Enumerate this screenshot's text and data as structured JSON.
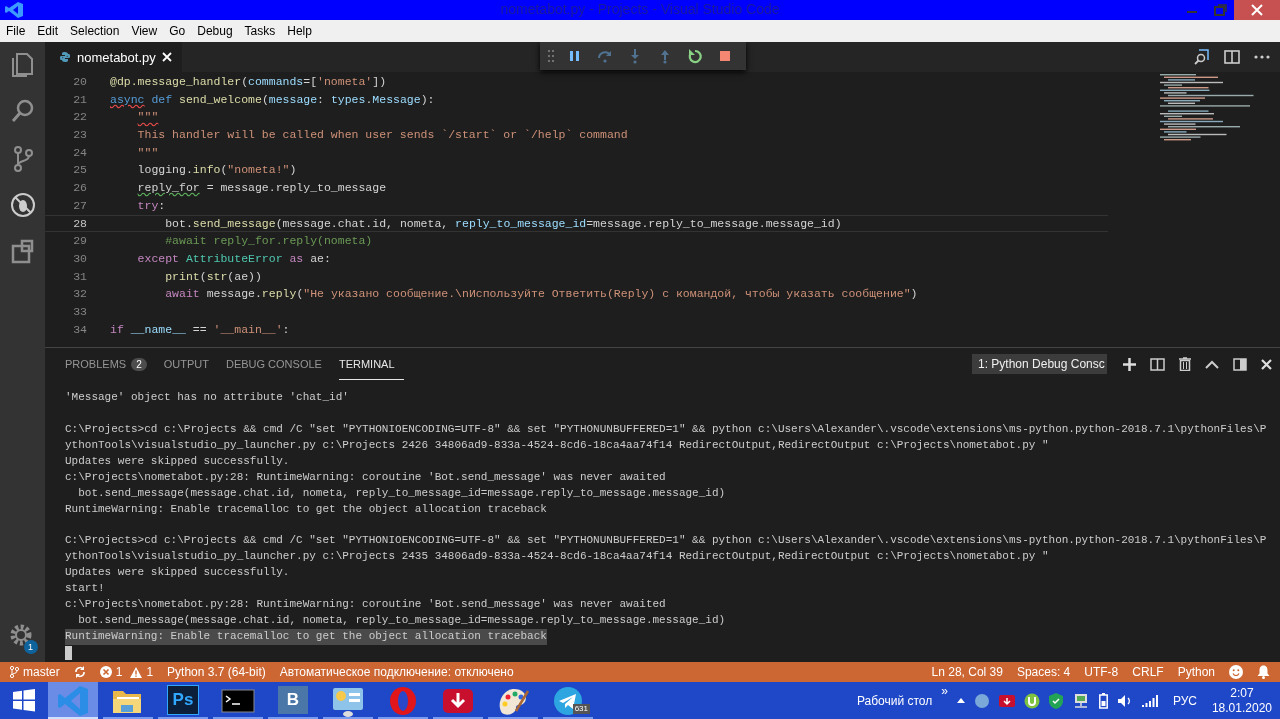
{
  "window": {
    "title": "nometabot.py - Projects - Visual Studio Code"
  },
  "menu": [
    "File",
    "Edit",
    "Selection",
    "View",
    "Go",
    "Debug",
    "Tasks",
    "Help"
  ],
  "activity_bar": {
    "items": [
      {
        "kind": "files",
        "selected": false
      },
      {
        "kind": "search",
        "selected": false
      },
      {
        "kind": "git",
        "selected": false
      },
      {
        "kind": "debug",
        "selected": true
      },
      {
        "kind": "extensions",
        "selected": false
      }
    ],
    "settings_badge": "1"
  },
  "editor": {
    "tabs": [
      {
        "label": "nometabot.py",
        "selected": true
      }
    ],
    "debug_toolbar": [
      {
        "kind": "pause",
        "disabled": false
      },
      {
        "kind": "step-over",
        "disabled": true
      },
      {
        "kind": "step-into",
        "disabled": true
      },
      {
        "kind": "step-out",
        "disabled": true
      },
      {
        "kind": "restart",
        "disabled": false
      },
      {
        "kind": "stop",
        "disabled": false
      }
    ],
    "lines": [
      {
        "number": "20",
        "current": false,
        "tokens": [
          {
            "kind": "fn",
            "text": "@dp.message_handler"
          },
          {
            "kind": "plain",
            "text": "("
          },
          {
            "kind": "var",
            "text": "commands"
          },
          {
            "kind": "plain",
            "text": "=["
          },
          {
            "kind": "str",
            "text": "'nometa'"
          },
          {
            "kind": "plain",
            "text": "])"
          }
        ]
      },
      {
        "number": "21",
        "current": false,
        "tokens": [
          {
            "kind": "kw",
            "text": "async",
            "error": true
          },
          {
            "kind": "kw",
            "text": " def"
          },
          {
            "kind": "fn",
            "text": " send_welcome"
          },
          {
            "kind": "plain",
            "text": "("
          },
          {
            "kind": "var",
            "text": "message"
          },
          {
            "kind": "plain",
            "text": ": "
          },
          {
            "kind": "var",
            "text": "types"
          },
          {
            "kind": "plain",
            "text": "."
          },
          {
            "kind": "var",
            "text": "Message"
          },
          {
            "kind": "plain",
            "text": "):"
          }
        ]
      },
      {
        "number": "22",
        "current": false,
        "tokens": [
          {
            "kind": "str",
            "text": "    \"\"\"",
            "error": true
          }
        ]
      },
      {
        "number": "23",
        "current": false,
        "tokens": [
          {
            "kind": "str",
            "text": "    This handler will be called when user sends `/start` or `/help` command"
          }
        ]
      },
      {
        "number": "24",
        "current": false,
        "tokens": [
          {
            "kind": "str",
            "text": "    \"\"\""
          }
        ]
      },
      {
        "number": "25",
        "current": false,
        "tokens": [
          {
            "kind": "plain",
            "text": "    logging."
          },
          {
            "kind": "fn",
            "text": "info"
          },
          {
            "kind": "plain",
            "text": "("
          },
          {
            "kind": "str",
            "text": "\"nometa!\""
          },
          {
            "kind": "plain",
            "text": ")"
          }
        ]
      },
      {
        "number": "26",
        "current": false,
        "tokens": [
          {
            "kind": "plain",
            "text": "    reply_for",
            "warning": true
          },
          {
            "kind": "plain",
            "text": " = message.reply_to_message"
          }
        ]
      },
      {
        "number": "27",
        "current": false,
        "tokens": [
          {
            "kind": "ctl",
            "text": "    try"
          },
          {
            "kind": "plain",
            "text": ":"
          }
        ]
      },
      {
        "number": "28",
        "current": true,
        "tokens": [
          {
            "kind": "plain",
            "text": "        bot."
          },
          {
            "kind": "fn",
            "text": "send_message"
          },
          {
            "kind": "plain",
            "text": "(message.chat.id, nometa,"
          },
          {
            "kind": "var",
            "text": " reply_to_message_id"
          },
          {
            "kind": "plain",
            "text": "=message.reply_to_message.message_id)"
          }
        ]
      },
      {
        "number": "29",
        "current": false,
        "tokens": [
          {
            "kind": "com",
            "text": "        #await reply_for.reply(nometa)"
          }
        ]
      },
      {
        "number": "30",
        "current": false,
        "tokens": [
          {
            "kind": "ctl",
            "text": "    except"
          },
          {
            "kind": "cls",
            "text": " AttributeError"
          },
          {
            "kind": "ctl",
            "text": " as"
          },
          {
            "kind": "plain",
            "text": " ae:"
          }
        ]
      },
      {
        "number": "31",
        "current": false,
        "tokens": [
          {
            "kind": "fn",
            "text": "        print"
          },
          {
            "kind": "plain",
            "text": "("
          },
          {
            "kind": "fn",
            "text": "str"
          },
          {
            "kind": "plain",
            "text": "(ae))"
          }
        ]
      },
      {
        "number": "32",
        "current": false,
        "tokens": [
          {
            "kind": "ctl",
            "text": "        await"
          },
          {
            "kind": "plain",
            "text": " message."
          },
          {
            "kind": "fn",
            "text": "reply"
          },
          {
            "kind": "plain",
            "text": "("
          },
          {
            "kind": "str",
            "text": "\"Не указано сообщение.\\nИспользуйте Ответить(Reply) с командой, чтобы указать сообщение\""
          },
          {
            "kind": "plain",
            "text": ")"
          }
        ]
      },
      {
        "number": "33",
        "current": false
      },
      {
        "number": "34",
        "current": false,
        "tokens": [
          {
            "kind": "ctl",
            "text": "if"
          },
          {
            "kind": "var",
            "text": " __name__"
          },
          {
            "kind": "plain",
            "text": " == "
          },
          {
            "kind": "str",
            "text": "'__main__'"
          },
          {
            "kind": "plain",
            "text": ":"
          }
        ]
      }
    ]
  },
  "panel": {
    "tabs": [
      {
        "label": "PROBLEMS",
        "badge": "2",
        "selected": false
      },
      {
        "label": "OUTPUT",
        "selected": false
      },
      {
        "label": "DEBUG CONSOLE",
        "selected": false
      },
      {
        "label": "TERMINAL",
        "selected": true
      }
    ],
    "terminal_select": "1: Python Debug Consc",
    "terminal": [
      {
        "kind": "text",
        "text": "'Message' object has no attribute 'chat_id'",
        "selected": false
      },
      {
        "kind": "blank",
        "selected": false
      },
      {
        "kind": "text",
        "text": "C:\\Projects>cd c:\\Projects && cmd /C \"set \"PYTHONIOENCODING=UTF-8\" && set \"PYTHONUNBUFFERED=1\" && python c:\\Users\\Alexander\\.vscode\\extensions\\ms-python.python-2018.7.1\\pythonFiles\\P",
        "selected": false
      },
      {
        "kind": "text",
        "text": "ythonTools\\visualstudio_py_launcher.py c:\\Projects 2426 34806ad9-833a-4524-8cd6-18ca4aa74f14 RedirectOutput,RedirectOutput c:\\Projects\\nometabot.py \"",
        "selected": false
      },
      {
        "kind": "text",
        "text": "Updates were skipped successfully.",
        "selected": false
      },
      {
        "kind": "text",
        "text": "c:\\Projects\\nometabot.py:28: RuntimeWarning: coroutine 'Bot.send_message' was never awaited",
        "selected": false
      },
      {
        "kind": "text",
        "text": "  bot.send_message(message.chat.id, nometa, reply_to_message_id=message.reply_to_message.message_id)",
        "selected": false
      },
      {
        "kind": "text",
        "text": "RuntimeWarning: Enable tracemalloc to get the object allocation traceback",
        "selected": false
      },
      {
        "kind": "blank",
        "selected": false
      },
      {
        "kind": "text",
        "text": "C:\\Projects>cd c:\\Projects && cmd /C \"set \"PYTHONIOENCODING=UTF-8\" && set \"PYTHONUNBUFFERED=1\" && python c:\\Users\\Alexander\\.vscode\\extensions\\ms-python.python-2018.7.1\\pythonFiles\\P",
        "selected": false
      },
      {
        "kind": "text",
        "text": "ythonTools\\visualstudio_py_launcher.py c:\\Projects 2435 34806ad9-833a-4524-8cd6-18ca4aa74f14 RedirectOutput,RedirectOutput c:\\Projects\\nometabot.py \"",
        "selected": false
      },
      {
        "kind": "text",
        "text": "Updates were skipped successfully.",
        "selected": false
      },
      {
        "kind": "text",
        "text": "start!",
        "selected": false
      },
      {
        "kind": "text",
        "text": "c:\\Projects\\nometabot.py:28: RuntimeWarning: coroutine 'Bot.send_message' was never awaited",
        "selected": false
      },
      {
        "kind": "text",
        "text": "  bot.send_message(message.chat.id, nometa, reply_to_message_id=message.reply_to_message.message_id)",
        "selected": false
      },
      {
        "kind": "text",
        "text": "RuntimeWarning: Enable tracemalloc to get the object allocation traceback",
        "selected": true
      },
      {
        "kind": "cursor",
        "selected": false
      }
    ]
  },
  "status_bar": {
    "branch": "master",
    "errors": "1",
    "warnings": "1",
    "interpreter": "Python 3.7 (64-bit)",
    "message": "Автоматическое подключение: отключено",
    "position": "Ln 28, Col 39",
    "indent": "Spaces: 4",
    "encoding": "UTF-8",
    "eol": "CRLF",
    "language": "Python"
  },
  "taskbar": {
    "apps": [
      {
        "kind": "vscode",
        "active": true
      },
      {
        "kind": "explorer",
        "active": false
      },
      {
        "kind": "photoshop",
        "label": "Ps",
        "active": false
      },
      {
        "kind": "cmd",
        "active": false
      },
      {
        "kind": "vk",
        "label": "B",
        "active": false
      },
      {
        "kind": "control",
        "active": false
      },
      {
        "kind": "opera",
        "active": false
      },
      {
        "kind": "download",
        "active": false
      },
      {
        "kind": "paint",
        "active": false
      },
      {
        "kind": "telegram",
        "badge": "631",
        "active": false
      }
    ],
    "toolbar_label": "Рабочий стол",
    "toolbar_chevron": "»",
    "language": "РУС",
    "time": "2:07",
    "date": "18.01.2020"
  }
}
